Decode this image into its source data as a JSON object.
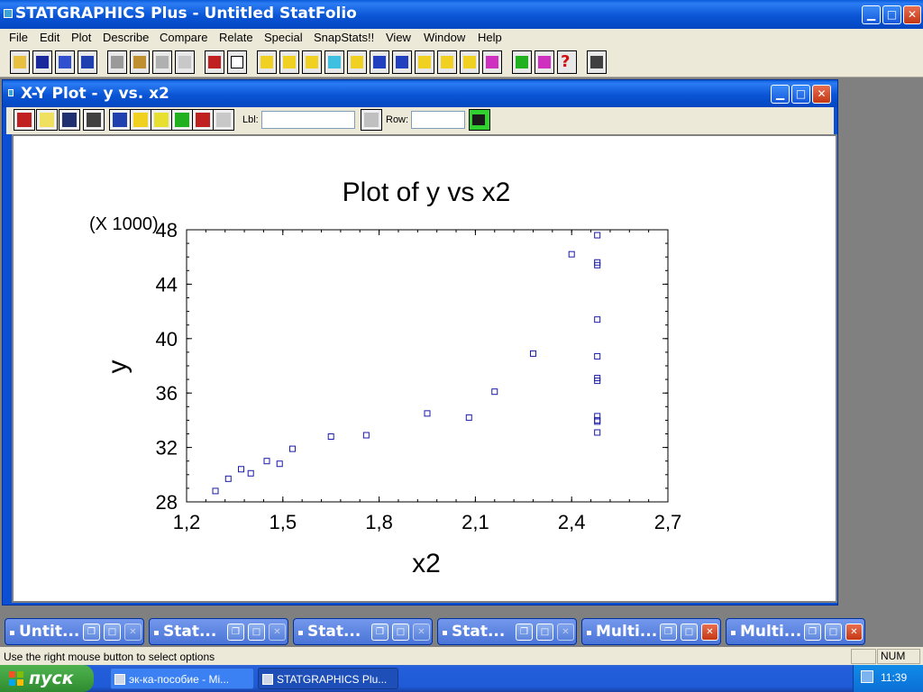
{
  "app": {
    "title": "STATGRAPHICS Plus - Untitled StatFolio"
  },
  "menus": [
    "File",
    "Edit",
    "Plot",
    "Describe",
    "Compare",
    "Relate",
    "Special",
    "SnapStats!!",
    "View",
    "Window",
    "Help"
  ],
  "doc_window": {
    "title": "X-Y Plot - y vs. x2",
    "toolbar": {
      "label_lbl": "Lbl:",
      "label_row": "Row:",
      "lbl_value": "",
      "row_value": ""
    }
  },
  "chart_data": {
    "type": "scatter",
    "title": "Plot of y vs x2",
    "xlabel": "x2",
    "ylabel": "y",
    "y_multiplier": "(X 1000)",
    "xlim": [
      1.2,
      2.7
    ],
    "ylim": [
      28,
      48
    ],
    "x_ticks": [
      "1,2",
      "1,5",
      "1,8",
      "2,1",
      "2,4",
      "2,7"
    ],
    "y_ticks": [
      "28",
      "32",
      "36",
      "40",
      "44",
      "48"
    ],
    "x_tick_values": [
      1.2,
      1.5,
      1.8,
      2.1,
      2.4,
      2.7
    ],
    "y_tick_values": [
      28,
      32,
      36,
      40,
      44,
      48
    ],
    "marker_color": "#1a1aa8",
    "points": [
      {
        "x": 1.29,
        "y": 28.8
      },
      {
        "x": 1.33,
        "y": 29.7
      },
      {
        "x": 1.37,
        "y": 30.4
      },
      {
        "x": 1.4,
        "y": 30.1
      },
      {
        "x": 1.45,
        "y": 31.0
      },
      {
        "x": 1.49,
        "y": 30.8
      },
      {
        "x": 1.53,
        "y": 31.9
      },
      {
        "x": 1.65,
        "y": 32.8
      },
      {
        "x": 1.76,
        "y": 32.9
      },
      {
        "x": 1.95,
        "y": 34.5
      },
      {
        "x": 2.08,
        "y": 34.2
      },
      {
        "x": 2.16,
        "y": 36.1
      },
      {
        "x": 2.28,
        "y": 38.9
      },
      {
        "x": 2.4,
        "y": 46.2
      },
      {
        "x": 2.48,
        "y": 47.6
      },
      {
        "x": 2.48,
        "y": 45.6
      },
      {
        "x": 2.48,
        "y": 45.4
      },
      {
        "x": 2.48,
        "y": 41.4
      },
      {
        "x": 2.48,
        "y": 38.7
      },
      {
        "x": 2.48,
        "y": 37.1
      },
      {
        "x": 2.48,
        "y": 36.9
      },
      {
        "x": 2.48,
        "y": 34.3
      },
      {
        "x": 2.48,
        "y": 34.0
      },
      {
        "x": 2.48,
        "y": 33.9
      },
      {
        "x": 2.48,
        "y": 33.1
      }
    ]
  },
  "mdi_tabs": [
    "Untit...",
    "Stat...",
    "Stat...",
    "Stat...",
    "Multi...",
    "Multi..."
  ],
  "status": {
    "message": "Use the right mouse button to select options",
    "num": "NUM"
  },
  "taskbar": {
    "start_label": "пуск",
    "tasks": [
      "эк-ка-пособие - Mi...",
      "STATGRAPHICS Plu..."
    ],
    "clock": "11:39"
  }
}
